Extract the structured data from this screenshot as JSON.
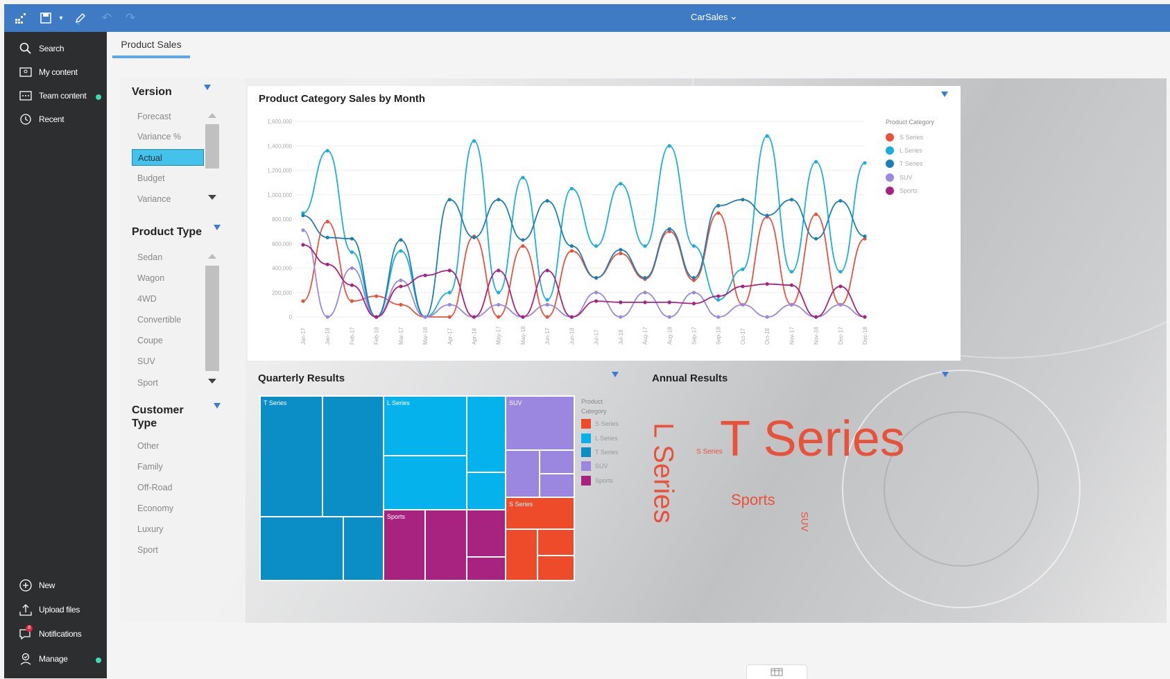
{
  "app": {
    "title": "CarSales",
    "brand_color": "#3f7bc5",
    "sidebar_color": "#2d2e30"
  },
  "toolbar": {
    "icons": [
      "grid-apps-icon",
      "save-icon",
      "pencil-edit-icon",
      "undo-icon",
      "redo-icon"
    ]
  },
  "nav": {
    "top": [
      {
        "label": "Search",
        "icon": "search-icon"
      },
      {
        "label": "My content",
        "icon": "folder-user-icon"
      },
      {
        "label": "Team content",
        "icon": "folder-team-icon"
      },
      {
        "label": "Recent",
        "icon": "clock-icon"
      }
    ],
    "bottom": [
      {
        "label": "New",
        "icon": "plus-circle-icon"
      },
      {
        "label": "Upload files",
        "icon": "upload-icon"
      },
      {
        "label": "Notifications",
        "icon": "chat-icon",
        "badge": "8"
      },
      {
        "label": "Manage",
        "icon": "manage-user-icon"
      }
    ]
  },
  "tabs": [
    {
      "label": "Product Sales",
      "active": true
    }
  ],
  "filters": {
    "version": {
      "title": "Version",
      "items": [
        "Forecast",
        "Variance %",
        "Actual",
        "Budget",
        "Variance"
      ],
      "selected": "Actual"
    },
    "product_type": {
      "title": "Product Type",
      "items": [
        "Sedan",
        "Wagon",
        "4WD",
        "Convertible",
        "Coupe",
        "SUV",
        "Sport"
      ]
    },
    "customer_type": {
      "title": "Customer Type",
      "title_line1": "Customer",
      "title_line2": "Type",
      "items": [
        "Other",
        "Family",
        "Off-Road",
        "Economy",
        "Luxury",
        "Sport"
      ]
    }
  },
  "chart_data": [
    {
      "type": "line",
      "title": "Product Category Sales by Month",
      "legend_title": "Product Category",
      "legend_position": "right",
      "x": [
        "Jan-17",
        "Jan-18",
        "Feb-17",
        "Feb-18",
        "Mar-17",
        "Mar-18",
        "Apr-17",
        "Apr-18",
        "May-17",
        "May-18",
        "Jun-17",
        "Jun-18",
        "Jul-17",
        "Jul-18",
        "Aug-17",
        "Aug-18",
        "Sep-17",
        "Sep-18",
        "Oct-17",
        "Oct-18",
        "Nov-17",
        "Nov-18",
        "Dec-17",
        "Dec-18"
      ],
      "ylim": [
        0,
        1600000
      ],
      "yticks": [
        "1,600,000",
        "1,400,000",
        "1,200,000",
        "1,000,000",
        "800,000",
        "600,000",
        "400,000",
        "200,000",
        "0"
      ],
      "grid": true,
      "series": [
        {
          "name": "S Series",
          "color": "#e8523b",
          "values": [
            130000,
            780000,
            130000,
            170000,
            100000,
            0,
            0,
            660000,
            0,
            580000,
            0,
            540000,
            320000,
            520000,
            310000,
            700000,
            300000,
            850000,
            100000,
            820000,
            100000,
            840000,
            100000,
            640000
          ]
        },
        {
          "name": "L Series",
          "color": "#1aaee0",
          "values": [
            850000,
            1360000,
            530000,
            0,
            540000,
            0,
            200000,
            1440000,
            200000,
            1140000,
            140000,
            1050000,
            580000,
            1090000,
            580000,
            1400000,
            580000,
            140000,
            390000,
            1480000,
            370000,
            1270000,
            370000,
            1260000
          ]
        },
        {
          "name": "T Series",
          "color": "#1b7fb5",
          "values": [
            830000,
            650000,
            640000,
            0,
            630000,
            0,
            960000,
            650000,
            960000,
            630000,
            950000,
            580000,
            320000,
            550000,
            320000,
            720000,
            320000,
            910000,
            960000,
            830000,
            960000,
            640000,
            950000,
            660000
          ]
        },
        {
          "name": "SUV",
          "color": "#9b87e0",
          "values": [
            710000,
            0,
            400000,
            0,
            300000,
            0,
            100000,
            0,
            100000,
            0,
            100000,
            0,
            200000,
            0,
            200000,
            0,
            200000,
            0,
            100000,
            0,
            100000,
            0,
            100000,
            0
          ]
        },
        {
          "name": "Sports",
          "color": "#a8237f",
          "values": [
            590000,
            430000,
            260000,
            0,
            250000,
            340000,
            380000,
            0,
            380000,
            0,
            380000,
            0,
            130000,
            120000,
            120000,
            120000,
            110000,
            170000,
            250000,
            270000,
            260000,
            0,
            250000,
            0
          ]
        }
      ]
    },
    {
      "type": "treemap",
      "title": "Quarterly Results",
      "legend_title": "Product Category",
      "legend_position": "right",
      "categories": [
        "T Series",
        "L Series",
        "SUV",
        "Sports",
        "S Series"
      ]
    },
    {
      "type": "wordcloud",
      "title": "Annual Results",
      "words": [
        {
          "text": "T Series"
        },
        {
          "text": "L Series"
        },
        {
          "text": "Sports"
        },
        {
          "text": "S Series"
        },
        {
          "text": "SUV"
        }
      ]
    }
  ],
  "legend_colors": {
    "S Series": "#e8523b",
    "L Series": "#1aaee0",
    "T Series": "#1b7fb5",
    "SUV": "#9b87e0",
    "Sports": "#a8237f"
  },
  "bottom_button_icon": "table-icon"
}
